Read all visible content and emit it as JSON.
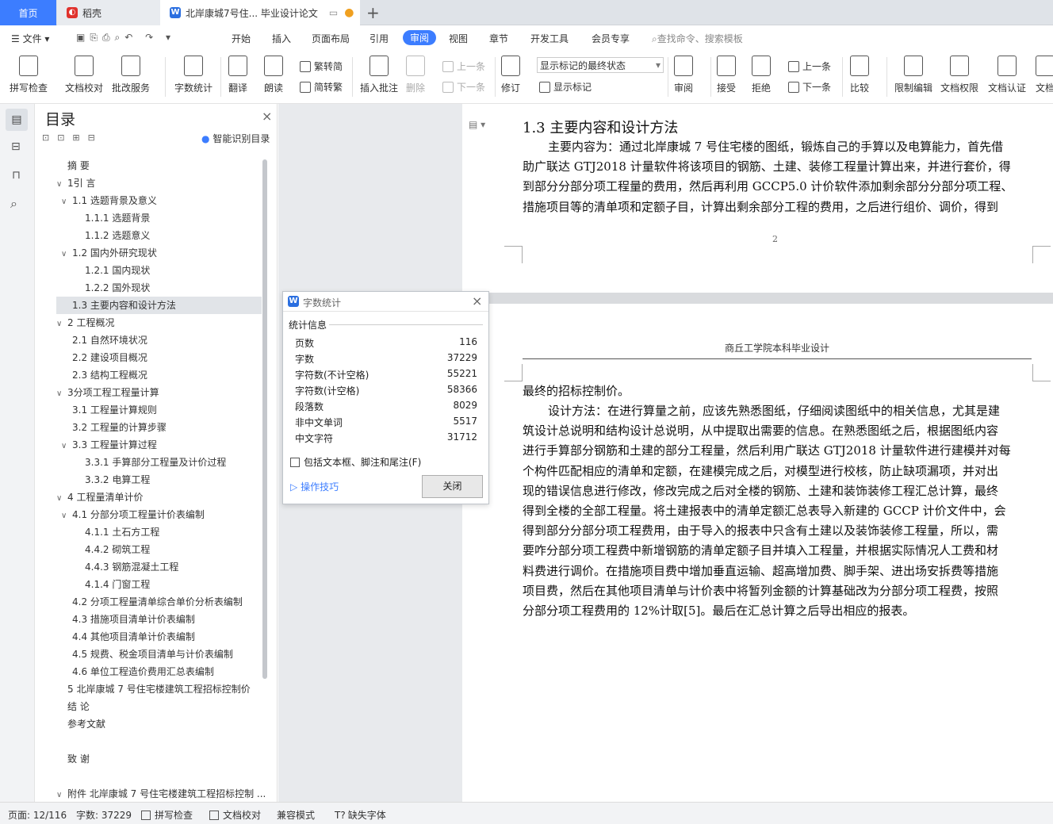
{
  "tabs": {
    "home": "首页",
    "daoke": "稻壳",
    "doc": "北岸康城7号住... 毕业设计论文"
  },
  "menu": [
    "文件",
    "开始",
    "插入",
    "页面布局",
    "引用",
    "审阅",
    "视图",
    "章节",
    "开发工具",
    "会员专享"
  ],
  "menu_active": "审阅",
  "search_placeholder": "查找命令、搜索模板",
  "ribbon": {
    "spellcheck": "拼写检查",
    "doccheck": "文档校对",
    "batch": "批改服务",
    "wordcount": "字数统计",
    "translate": "翻译",
    "read": "朗读",
    "trad": "繁转简",
    "simp": "简转繁",
    "insert_comment": "插入批注",
    "delete": "删除",
    "prev_comment": "上一条",
    "next_comment": "下一条",
    "revise": "修订",
    "display_select": "显示标记的最终状态",
    "show_marks": "显示标记",
    "review": "审阅",
    "accept": "接受",
    "reject": "拒绝",
    "prev": "上一条",
    "next": "下一条",
    "compare": "比较",
    "restrict": "限制编辑",
    "perm": "文档权限",
    "cert": "文档认证",
    "last": "文档"
  },
  "nav": {
    "title": "目录",
    "smart": "智能识别目录"
  },
  "toc": [
    {
      "text": "摘  要",
      "level": 0,
      "arrow": ""
    },
    {
      "text": "1引  言",
      "level": 0,
      "arrow": "∨"
    },
    {
      "text": "1.1 选题背景及意义",
      "level": 1,
      "arrow": "∨"
    },
    {
      "text": "1.1.1  选题背景",
      "level": 2,
      "arrow": ""
    },
    {
      "text": "1.1.2  选题意义",
      "level": 2,
      "arrow": ""
    },
    {
      "text": "1.2  国内外研究现状",
      "level": 1,
      "arrow": "∨"
    },
    {
      "text": "1.2.1  国内现状",
      "level": 2,
      "arrow": ""
    },
    {
      "text": "1.2.2  国外现状",
      "level": 2,
      "arrow": ""
    },
    {
      "text": "1.3  主要内容和设计方法",
      "level": 1,
      "arrow": "",
      "active": true
    },
    {
      "text": "2  工程概况",
      "level": 0,
      "arrow": "∨"
    },
    {
      "text": "2.1  自然环境状况",
      "level": 1,
      "arrow": ""
    },
    {
      "text": "2.2  建设项目概况",
      "level": 1,
      "arrow": ""
    },
    {
      "text": "2.3  结构工程概况",
      "level": 1,
      "arrow": ""
    },
    {
      "text": "3分项工程工程量计算",
      "level": 0,
      "arrow": "∨"
    },
    {
      "text": "3.1  工程量计算规则",
      "level": 1,
      "arrow": ""
    },
    {
      "text": "3.2  工程量的计算步骤",
      "level": 1,
      "arrow": ""
    },
    {
      "text": "3.3  工程量计算过程",
      "level": 1,
      "arrow": "∨"
    },
    {
      "text": "3.3.1  手算部分工程量及计价过程",
      "level": 2,
      "arrow": ""
    },
    {
      "text": "3.3.2  电算工程",
      "level": 2,
      "arrow": ""
    },
    {
      "text": "4  工程量清单计价",
      "level": 0,
      "arrow": "∨"
    },
    {
      "text": "4.1  分部分项工程量计价表编制",
      "level": 1,
      "arrow": "∨"
    },
    {
      "text": "4.1.1  土石方工程",
      "level": 2,
      "arrow": ""
    },
    {
      "text": "4.4.2  砌筑工程",
      "level": 2,
      "arrow": ""
    },
    {
      "text": "4.4.3  钢筋混凝土工程",
      "level": 2,
      "arrow": ""
    },
    {
      "text": "4.1.4  门窗工程",
      "level": 2,
      "arrow": ""
    },
    {
      "text": "4.2  分项工程量清单综合单价分析表编制",
      "level": 1,
      "arrow": ""
    },
    {
      "text": "4.3  措施项目清单计价表编制",
      "level": 1,
      "arrow": ""
    },
    {
      "text": "4.4  其他项目清单计价表编制",
      "level": 1,
      "arrow": ""
    },
    {
      "text": "4.5  规费、税金项目清单与计价表编制",
      "level": 1,
      "arrow": ""
    },
    {
      "text": "4.6  单位工程造价费用汇总表编制",
      "level": 1,
      "arrow": ""
    },
    {
      "text": "5  北岸康城 7 号住宅楼建筑工程招标控制价",
      "level": 0,
      "arrow": ""
    },
    {
      "text": "结  论",
      "level": 0,
      "arrow": ""
    },
    {
      "text": "参考文献",
      "level": 0,
      "arrow": ""
    },
    {
      "text": "致  谢",
      "level": 0,
      "arrow": "",
      "gap": true
    },
    {
      "text": "附件  北岸康城 7 号住宅楼建筑工程招标控制 ...",
      "level": 0,
      "arrow": "∨",
      "gap": true
    }
  ],
  "doc": {
    "heading": "1.3  主要内容和设计方法",
    "p1": [
      "主要内容为：通过北岸康城 7 号住宅楼的图纸，锻炼自己的手算以及电算能力，首先借",
      "助广联达 GTJ2018 计量软件将该项目的钢筋、土建、装修工程量计算出来，并进行套价，得",
      "到部分分部分项工程量的费用，然后再利用 GCCP5.0 计价软件添加剩余部分分部分项工程、",
      "措施项目等的清单项和定额子目，计算出剩余部分工程的费用，之后进行组价、调价，得到"
    ],
    "page_no": "2",
    "header": "商丘工学院本科毕业设计",
    "p2_first": "最终的招标控制价。",
    "p2": [
      "设计方法：在进行算量之前，应该先熟悉图纸，仔细阅读图纸中的相关信息，尤其是建",
      "筑设计总说明和结构设计总说明，从中提取出需要的信息。在熟悉图纸之后，根据图纸内容",
      "进行手算部分钢筋和土建的部分工程量，然后利用广联达 GTJ2018 计量软件进行建模并对每",
      "个构件匹配相应的清单和定额，在建模完成之后，对模型进行校核，防止缺项漏项，并对出",
      "现的错误信息进行修改，修改完成之后对全楼的钢筋、土建和装饰装修工程汇总计算，最终",
      "得到全楼的全部工程量。将土建报表中的清单定额汇总表导入新建的 GCCP 计价文件中，会",
      "得到部分分部分项工程费用，由于导入的报表中只含有土建以及装饰装修工程量，所以，需",
      "要咋分部分项工程费中新增钢筋的清单定额子目并填入工程量，并根据实际情况人工费和材",
      "料费进行调价。在措施项目费中增加垂直运输、超高增加费、脚手架、进出场安拆费等措施",
      "项目费，然后在其他项目清单与计价表中将暂列金额的计算基础改为分部分项工程费，按照",
      "分部分项工程费用的 12%计取[5]。最后在汇总计算之后导出相应的报表。"
    ]
  },
  "dialog": {
    "title": "字数统计",
    "section": "统计信息",
    "rows": [
      {
        "label": "页数",
        "value": "116"
      },
      {
        "label": "字数",
        "value": "37229"
      },
      {
        "label": "字符数(不计空格)",
        "value": "55221"
      },
      {
        "label": "字符数(计空格)",
        "value": "58366"
      },
      {
        "label": "段落数",
        "value": "8029"
      },
      {
        "label": "非中文单词",
        "value": "5517"
      },
      {
        "label": "中文字符",
        "value": "31712"
      }
    ],
    "checkbox": "包括文本框、脚注和尾注(F)",
    "tips": "操作技巧",
    "close": "关闭"
  },
  "status": {
    "page": "页面: 12/116",
    "words": "字数: 37229",
    "spell": "拼写检查",
    "proof": "文档校对",
    "compat": "兼容模式",
    "font": "缺失字体"
  },
  "colors": {
    "accent": "#3c7dff",
    "active_toc": "#e1e4e8"
  }
}
